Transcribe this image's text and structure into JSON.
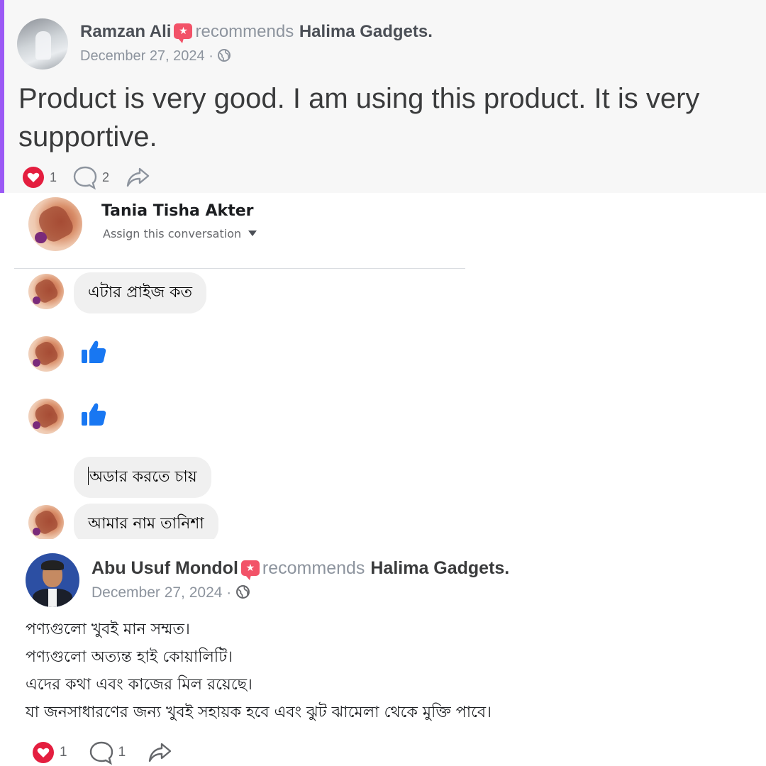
{
  "review_1": {
    "author": "Ramzan Ali",
    "recommends_label": "recommends",
    "page_name": "Halima Gadgets.",
    "date": "December 27, 2024 ·",
    "text": "Product is very good. I am using this product. It is very supportive.",
    "reactions": {
      "love_count": "1",
      "comment_count": "2"
    }
  },
  "chat": {
    "contact_name": "Tania Tisha Akter",
    "assign_label": "Assign this conversation",
    "messages": [
      {
        "type": "text",
        "text": "এটার প্রাইজ কত"
      },
      {
        "type": "like"
      },
      {
        "type": "like"
      },
      {
        "type": "text",
        "text": "অডার করতে চায়"
      },
      {
        "type": "text",
        "text": "আমার নাম তানিশা"
      }
    ]
  },
  "review_2": {
    "author": "Abu Usuf Mondol",
    "recommends_label": "recommends",
    "page_name": "Halima Gadgets.",
    "date": "December 27, 2024 ·",
    "lines": [
      "পণ্যগুলো খুবই মান সম্মত।",
      "পণ্যগুলো অত্যন্ত হাই কোয়ালিটি।",
      "এদের কথা এবং কাজের মিল রয়েছে।",
      "যা জনসাধারণের জন্য খুবই সহায়ক হবে এবং ঝুট ঝামেলা থেকে মুক্তি পাবে।"
    ],
    "reactions": {
      "love_count": "1",
      "comment_count": "1"
    }
  },
  "colors": {
    "accent_bar": "#9b59f5",
    "recommend_badge": "#f25268",
    "like_blue": "#1877f2",
    "love_red": "#e41e3f",
    "bubble_bg": "#f0f0f0"
  },
  "icons": [
    "recommend-badge-icon",
    "globe-icon",
    "love-reaction-icon",
    "comment-icon",
    "share-icon",
    "thumbs-up-icon",
    "dropdown-caret-icon"
  ]
}
